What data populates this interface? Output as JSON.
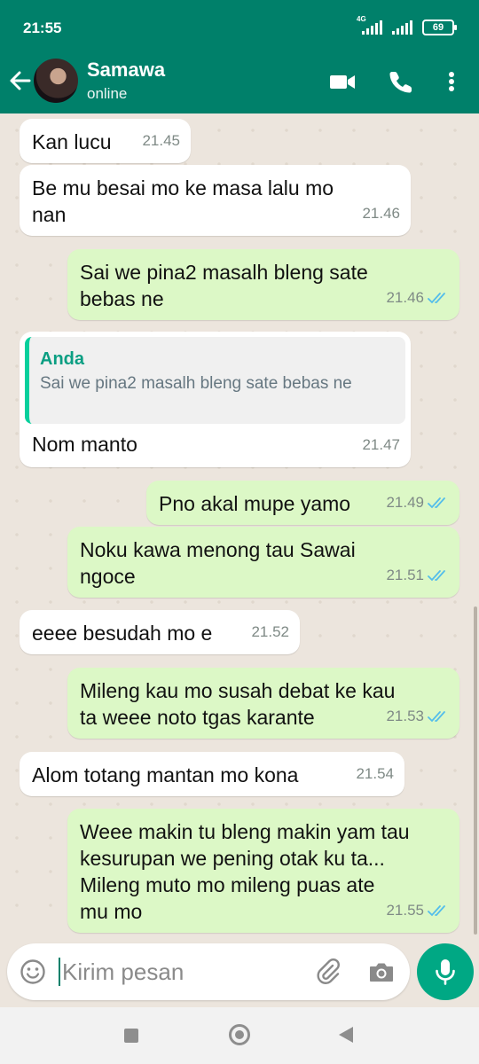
{
  "status_bar": {
    "time": "21:55",
    "network": "4G",
    "battery": "69"
  },
  "header": {
    "contact_name": "Samawa",
    "status": "online"
  },
  "messages": [
    {
      "dir": "in",
      "text": "Kan lucu",
      "time": "21.45"
    },
    {
      "dir": "in",
      "text": "Be mu besai mo ke masa lalu mo\nnan",
      "time": "21.46"
    },
    {
      "dir": "out",
      "text": "Sai we pina2 masalh bleng sate\nbebas ne",
      "time": "21.46",
      "read": true
    },
    {
      "dir": "in",
      "text": "Nom manto",
      "time": "21.47",
      "quote": {
        "author": "Anda",
        "text": "Sai we pina2 masalh bleng sate bebas ne"
      }
    },
    {
      "dir": "out",
      "text": "Pno akal mupe yamo",
      "time": "21.49",
      "read": true
    },
    {
      "dir": "out",
      "text": "Noku kawa menong tau Sawai\nngoce",
      "time": "21.51",
      "read": true
    },
    {
      "dir": "in",
      "text": "eeee besudah mo e",
      "time": "21.52"
    },
    {
      "dir": "out",
      "text": "Mileng kau mo susah debat ke kau\nta weee noto tgas karante",
      "time": "21.53",
      "read": true
    },
    {
      "dir": "in",
      "text": "Alom totang mantan mo kona",
      "time": "21.54"
    },
    {
      "dir": "out",
      "text": "Weee makin tu bleng makin yam tau\nkesurupan we pening otak ku ta...\nMileng muto mo mileng puas ate\nmu mo",
      "time": "21.55",
      "read": true
    }
  ],
  "composer": {
    "placeholder": "Kirim pesan"
  },
  "colors": {
    "header": "#00806a",
    "outgoing_bubble": "#dcf8c6",
    "read_ticks": "#53bdeb",
    "mic_button": "#00a884"
  }
}
